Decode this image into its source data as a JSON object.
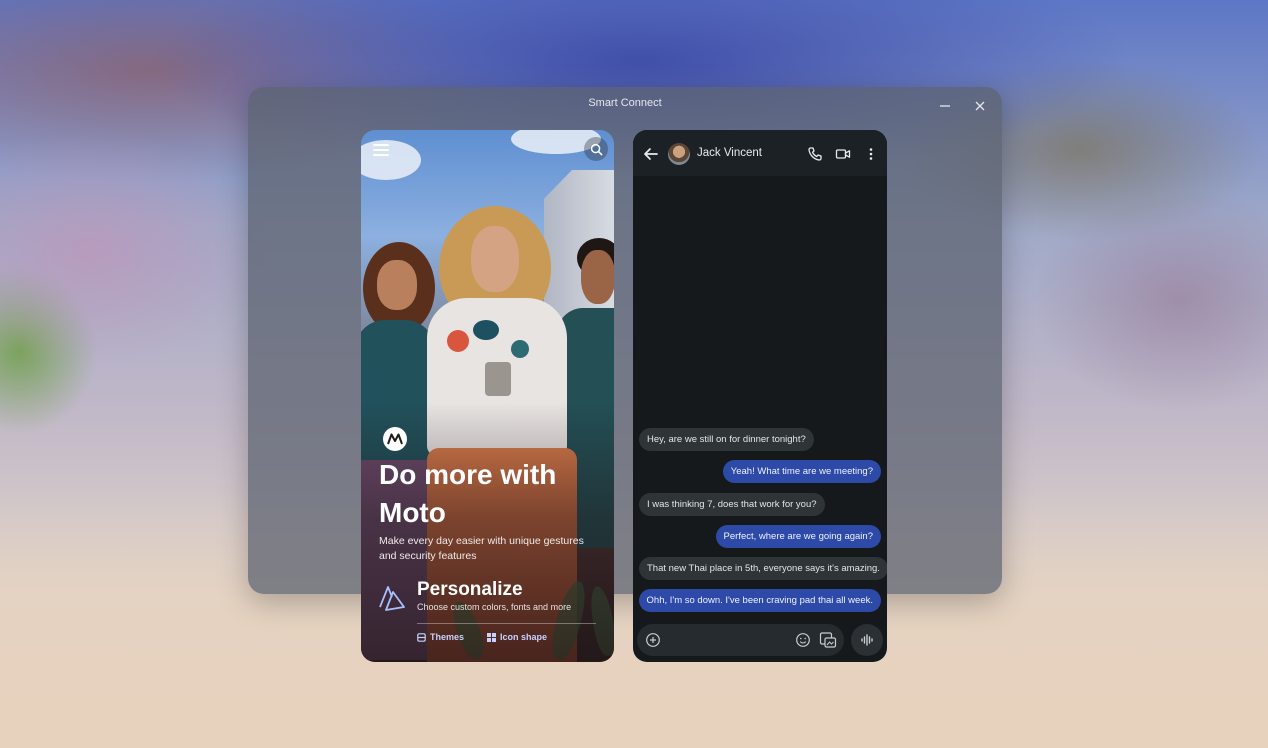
{
  "window": {
    "title": "Smart Connect",
    "minimize_icon": "minimize-icon",
    "close_icon": "close-icon"
  },
  "left_panel": {
    "hero_title": "Do more with Moto",
    "hero_subtitle": "Make every day easier with unique gestures and security features",
    "personalize_title": "Personalize",
    "personalize_subtitle": "Choose custom colors, fonts and more",
    "chips": [
      {
        "label": "Themes",
        "icon": "themes-icon"
      },
      {
        "label": "Icon shape",
        "icon": "grid-icon"
      }
    ]
  },
  "chat": {
    "contact_name": "Jack Vincent",
    "messages": [
      {
        "direction": "in",
        "text": "Hey, are we still on for dinner tonight?"
      },
      {
        "direction": "out",
        "text": "Yeah! What time are we meeting?"
      },
      {
        "direction": "in",
        "text": "I was thinking 7, does that work for you?"
      },
      {
        "direction": "out",
        "text": "Perfect, where are we going again?"
      },
      {
        "direction": "in",
        "text": "That new Thai place in 5th, everyone says it's amazing."
      },
      {
        "direction": "out",
        "text": "Ohh, I'm so down. I've been craving pad thai all week."
      }
    ]
  },
  "colors": {
    "outgoing_bubble": "#2d4aa8",
    "incoming_bubble": "#2f3437",
    "chip_accent": "#c6d3ff"
  }
}
